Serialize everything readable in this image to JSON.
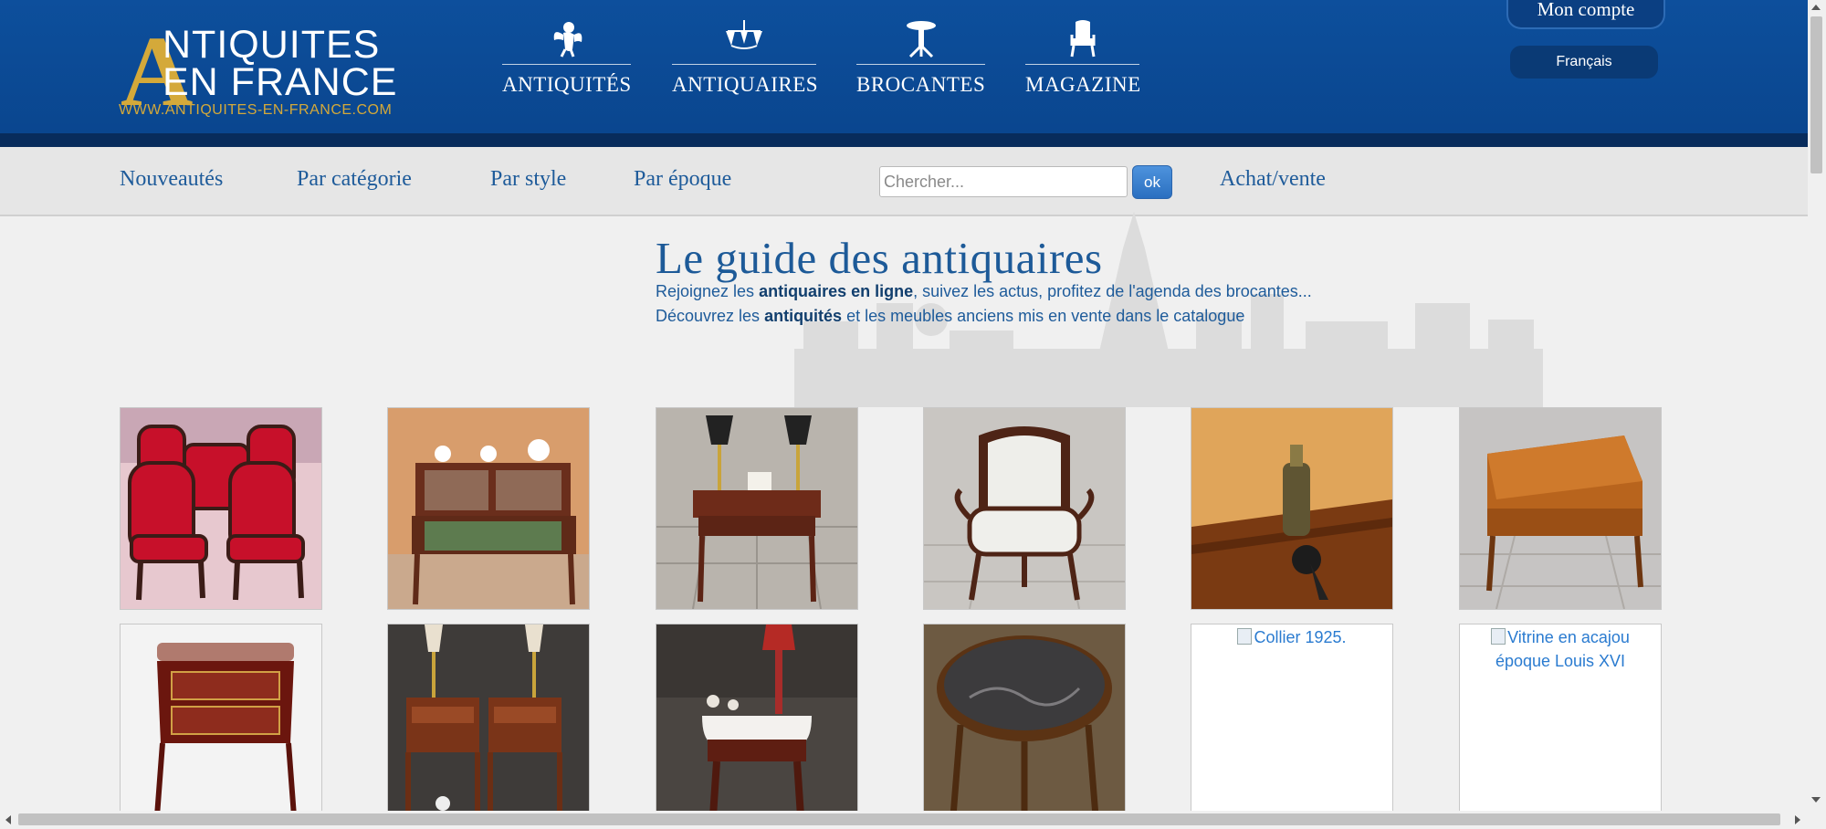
{
  "logo": {
    "big_letter": "A",
    "line1": "NTIQUITES",
    "line2": "EN FRANCE",
    "url": "WWW.ANTIQUITES-EN-FRANCE.COM"
  },
  "main_nav": [
    {
      "label": "ANTIQUITÉS",
      "icon": "cherub-icon"
    },
    {
      "label": "ANTIQUAIRES",
      "icon": "chandelier-icon"
    },
    {
      "label": "BROCANTES",
      "icon": "pedestal-table-icon"
    },
    {
      "label": "MAGAZINE",
      "icon": "armchair-icon"
    }
  ],
  "account": {
    "label": "Mon compte",
    "language": "Français"
  },
  "sub_nav": [
    "Nouveautés",
    "Par catégorie",
    "Par style",
    "Par époque",
    "Achat/vente"
  ],
  "search": {
    "placeholder": "Chercher...",
    "button": "ok"
  },
  "hero": {
    "title": "Le guide des antiquaires",
    "line1_before": "Rejoignez les ",
    "line1_bold": "antiquaires en ligne",
    "line1_after": ", suivez les actus, profitez de l'agenda des brocantes...",
    "line2_before": "Découvrez les ",
    "line2_bold": "antiquités",
    "line2_after": " et les meubles anciens mis en vente dans le catalogue"
  },
  "products": [
    {
      "subject": "red velvet chairs"
    },
    {
      "subject": "writing desk with porcelain"
    },
    {
      "subject": "side table with two lamps"
    },
    {
      "subject": "white upholstered armchair"
    },
    {
      "subject": "perfume atomizer on table"
    },
    {
      "subject": "slant-front desk"
    },
    {
      "subject": "marquetry commode"
    },
    {
      "subject": "pair of bedside tables"
    },
    {
      "subject": "marble-top console with lamp"
    },
    {
      "subject": "round marble-top table"
    },
    {
      "alt": "Collier 1925."
    },
    {
      "alt": "Vitrine en acajou époque Louis XVI"
    }
  ],
  "colors": {
    "header_blue": "#0d4f9c",
    "gold": "#d4a93a",
    "link_blue": "#1e5b9a"
  }
}
